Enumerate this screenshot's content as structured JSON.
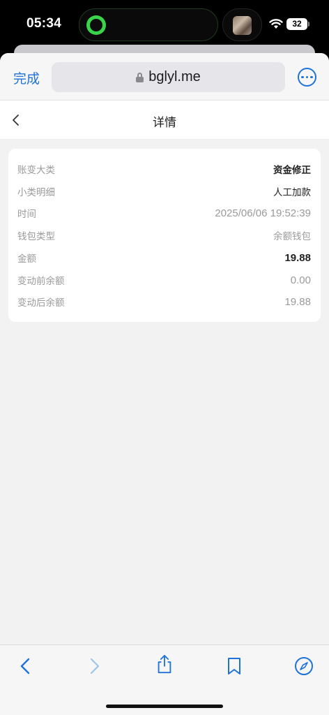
{
  "status_bar": {
    "time": "05:34",
    "battery": "32"
  },
  "browser": {
    "done_label": "完成",
    "url": "bglyl.me"
  },
  "page": {
    "title": "详情"
  },
  "details": [
    {
      "label": "账变大类",
      "value": "资金修正"
    },
    {
      "label": "小类明细",
      "value": "人工加款"
    },
    {
      "label": "时间",
      "value": "2025/06/06 19:52:39"
    },
    {
      "label": "钱包类型",
      "value": "余额钱包"
    },
    {
      "label": "金额",
      "value": "19.88"
    },
    {
      "label": "变动前余额",
      "value": "0.00"
    },
    {
      "label": "变动后余额",
      "value": "19.88"
    }
  ],
  "colors": {
    "accent": "#1f73d8",
    "background": "#f2f2f2",
    "card": "#ffffff",
    "muted_text": "#9a9a9a"
  },
  "toolbar": {
    "icons": [
      "back-icon",
      "forward-icon",
      "share-icon",
      "bookmarks-icon",
      "compass-icon"
    ]
  }
}
